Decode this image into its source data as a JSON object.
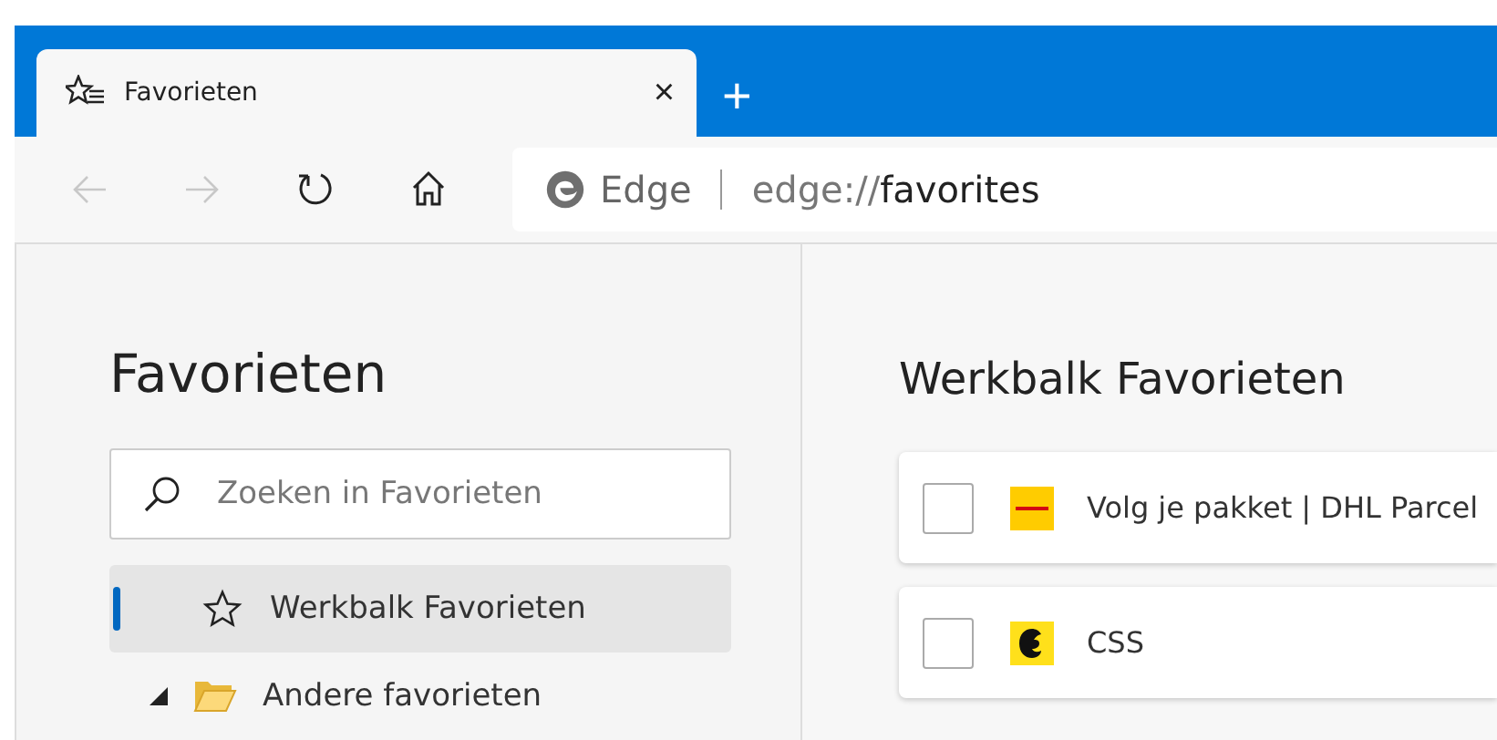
{
  "tab": {
    "title": "Favorieten",
    "close": "×",
    "new_tab": "+"
  },
  "toolbar": {
    "back_disabled": true,
    "forward_disabled": true,
    "site_label": "Edge",
    "url_scheme": "edge://",
    "url_path": "favorites"
  },
  "sidebar": {
    "heading": "Favorieten",
    "search": {
      "placeholder": "Zoeken in Favorieten"
    },
    "items": [
      {
        "label": "Werkbalk Favorieten",
        "kind": "star",
        "selected": true
      },
      {
        "label": "Andere favorieten",
        "kind": "folder",
        "selected": false,
        "expanded": true
      }
    ]
  },
  "main": {
    "heading": "Werkbalk Favorieten",
    "items": [
      {
        "title": "Volg je pakket | DHL Parcel",
        "checked": false,
        "kind": "dhl"
      },
      {
        "title": "CSS",
        "checked": false,
        "kind": "mono"
      }
    ]
  }
}
